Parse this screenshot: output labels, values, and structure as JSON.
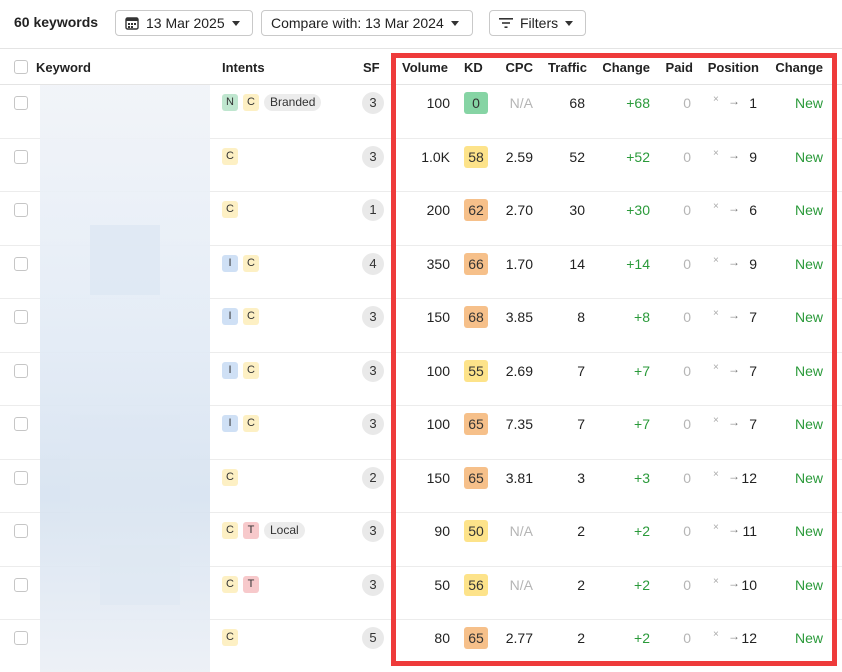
{
  "toolbar": {
    "keyword_count": "60 keywords",
    "date_label": "13 Mar 2025",
    "compare_label": "Compare with: 13 Mar 2024",
    "filters_label": "Filters"
  },
  "columns": {
    "keyword": "Keyword",
    "intents": "Intents",
    "sf": "SF",
    "volume": "Volume",
    "kd": "KD",
    "cpc": "CPC",
    "traffic": "Traffic",
    "traffic_change": "Change",
    "paid": "Paid",
    "position": "Position",
    "position_change": "Change"
  },
  "colors": {
    "kd_green": "#86d4a4",
    "kd_yellow": "#fde38a",
    "kd_orange": "#f6c08a",
    "highlight": "#ee3b3b",
    "positive": "#2a9a3a"
  },
  "rows": [
    {
      "intents": [
        "N",
        "C"
      ],
      "pill": "Branded",
      "sf": "3",
      "volume": "100",
      "kd": "0",
      "kd_color": "#86d4a4",
      "cpc": "N/A",
      "traffic": "68",
      "change": "+68",
      "paid": "0",
      "pos_from": "×",
      "position": "1",
      "pos_change": "New"
    },
    {
      "intents": [
        "C"
      ],
      "pill": "",
      "sf": "3",
      "volume": "1.0K",
      "kd": "58",
      "kd_color": "#fde38a",
      "cpc": "2.59",
      "traffic": "52",
      "change": "+52",
      "paid": "0",
      "pos_from": "×",
      "position": "9",
      "pos_change": "New"
    },
    {
      "intents": [
        "C"
      ],
      "pill": "",
      "sf": "1",
      "volume": "200",
      "kd": "62",
      "kd_color": "#f6c08a",
      "cpc": "2.70",
      "traffic": "30",
      "change": "+30",
      "paid": "0",
      "pos_from": "×",
      "position": "6",
      "pos_change": "New"
    },
    {
      "intents": [
        "I",
        "C"
      ],
      "pill": "",
      "sf": "4",
      "volume": "350",
      "kd": "66",
      "kd_color": "#f6c08a",
      "cpc": "1.70",
      "traffic": "14",
      "change": "+14",
      "paid": "0",
      "pos_from": "×",
      "position": "9",
      "pos_change": "New"
    },
    {
      "intents": [
        "I",
        "C"
      ],
      "pill": "",
      "sf": "3",
      "volume": "150",
      "kd": "68",
      "kd_color": "#f6c08a",
      "cpc": "3.85",
      "traffic": "8",
      "change": "+8",
      "paid": "0",
      "pos_from": "×",
      "position": "7",
      "pos_change": "New"
    },
    {
      "intents": [
        "I",
        "C"
      ],
      "pill": "",
      "sf": "3",
      "volume": "100",
      "kd": "55",
      "kd_color": "#fde38a",
      "cpc": "2.69",
      "traffic": "7",
      "change": "+7",
      "paid": "0",
      "pos_from": "×",
      "position": "7",
      "pos_change": "New"
    },
    {
      "intents": [
        "I",
        "C"
      ],
      "pill": "",
      "sf": "3",
      "volume": "100",
      "kd": "65",
      "kd_color": "#f6c08a",
      "cpc": "7.35",
      "traffic": "7",
      "change": "+7",
      "paid": "0",
      "pos_from": "×",
      "position": "7",
      "pos_change": "New"
    },
    {
      "intents": [
        "C"
      ],
      "pill": "",
      "sf": "2",
      "volume": "150",
      "kd": "65",
      "kd_color": "#f6c08a",
      "cpc": "3.81",
      "traffic": "3",
      "change": "+3",
      "paid": "0",
      "pos_from": "×",
      "position": "12",
      "pos_change": "New"
    },
    {
      "intents": [
        "C",
        "T"
      ],
      "pill": "Local",
      "sf": "3",
      "volume": "90",
      "kd": "50",
      "kd_color": "#fde38a",
      "cpc": "N/A",
      "traffic": "2",
      "change": "+2",
      "paid": "0",
      "pos_from": "×",
      "position": "11",
      "pos_change": "New"
    },
    {
      "intents": [
        "C",
        "T"
      ],
      "pill": "",
      "sf": "3",
      "volume": "50",
      "kd": "56",
      "kd_color": "#fde38a",
      "cpc": "N/A",
      "traffic": "2",
      "change": "+2",
      "paid": "0",
      "pos_from": "×",
      "position": "10",
      "pos_change": "New"
    },
    {
      "intents": [
        "C"
      ],
      "pill": "",
      "sf": "5",
      "volume": "80",
      "kd": "65",
      "kd_color": "#f6c08a",
      "cpc": "2.77",
      "traffic": "2",
      "change": "+2",
      "paid": "0",
      "pos_from": "×",
      "position": "12",
      "pos_change": "New"
    }
  ]
}
